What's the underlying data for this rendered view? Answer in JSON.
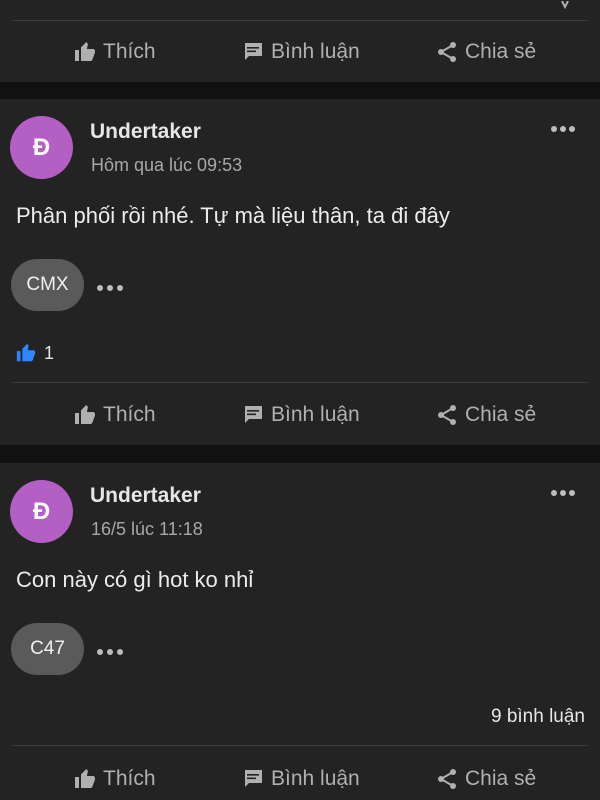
{
  "actions": {
    "like_label": "Thích",
    "comment_label": "Bình luận",
    "share_label": "Chia sẻ"
  },
  "posts": [
    {
      "author": "Undertaker",
      "avatar_letter": "Đ",
      "timestamp": "Hôm qua lúc 09:53",
      "text": "Phân phối rồi nhé. Tự mà liệu thân, ta đi đây",
      "tag": "CMX",
      "like_count": "1"
    },
    {
      "author": "Undertaker",
      "avatar_letter": "Đ",
      "timestamp": "16/5 lúc 11:18",
      "text": "Con này có gì hot ko nhỉ",
      "tag": "C47",
      "comment_count": "9 bình luận"
    }
  ],
  "icons": {
    "like": "thumbs-up-icon",
    "comment": "comment-icon",
    "share": "share-icon",
    "more": "more-options-icon"
  },
  "colors": {
    "page_background": "#111111",
    "card_background": "#232323",
    "avatar": "#b45fc4",
    "like_reaction": "#2d88ff",
    "tag_chip": "#5a5a5a"
  }
}
